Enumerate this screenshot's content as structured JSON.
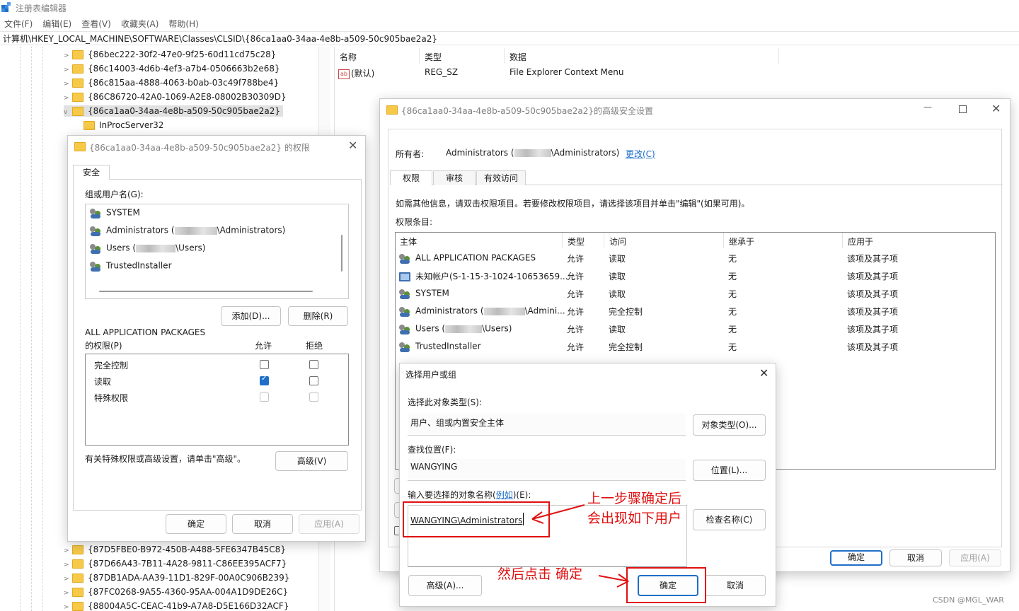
{
  "app": {
    "title": "注册表编辑器"
  },
  "menu": [
    "文件(F)",
    "编辑(E)",
    "查看(V)",
    "收藏夹(A)",
    "帮助(H)"
  ],
  "address": "计算机\\HKEY_LOCAL_MACHINE\\SOFTWARE\\Classes\\CLSID\\{86ca1aa0-34aa-4e8b-a509-50c905bae2a2}",
  "tree": {
    "top": [
      "{86bec222-30f2-47e0-9f25-60d11cd75c28}",
      "{86c14003-4d6b-4ef3-a7b4-0506663b2e68}",
      "{86c815aa-4888-4063-b0ab-03c49f788be4}",
      "{86C86720-42A0-1069-A2E8-08002B30309D}",
      "{86ca1aa0-34aa-4e8b-a509-50c905bae2a2}"
    ],
    "child": "InProcServer32",
    "bottom": [
      "{87D5FBE0-B972-450B-A488-5FE6347B45C8}",
      "{87D66A43-7B11-4A28-9811-C86EE395ACF7}",
      "{87DB1ADA-AA39-11D1-829F-00A0C906B239}",
      "{87FC0268-9A55-4360-95AA-004A1D9DE26C}",
      "{88004A5C-CEAC-41b9-A7A8-D5E166D32ACF}"
    ]
  },
  "values": {
    "headers": [
      "名称",
      "类型",
      "数据"
    ],
    "row": {
      "name": "(默认)",
      "type": "REG_SZ",
      "data": "File Explorer Context Menu"
    }
  },
  "perm": {
    "title": "{86ca1aa0-34aa-4e8b-a509-50c905bae2a2} 的权限",
    "tab": "安全",
    "group_label": "组或用户名(G):",
    "users": [
      {
        "pre": "SYSTEM",
        "post": ""
      },
      {
        "pre": "Administrators (",
        "post": "\\Administrators)"
      },
      {
        "pre": "Users (",
        "post": "\\Users)"
      },
      {
        "pre": "TrustedInstaller",
        "post": ""
      }
    ],
    "add": "添加(D)...",
    "remove": "删除(R)",
    "selected": "ALL APPLICATION PACKAGES",
    "perm_label": "的权限(P)",
    "allow": "允许",
    "deny": "拒绝",
    "rows": [
      {
        "label": "完全控制",
        "allow": false,
        "deny": false
      },
      {
        "label": "读取",
        "allow": true,
        "deny": false
      },
      {
        "label": "特殊权限",
        "allow": false,
        "deny": false
      }
    ],
    "adv_hint": "有关特殊权限或高级设置，请单击\"高级\"。",
    "advanced": "高级(V)",
    "ok": "确定",
    "cancel": "取消",
    "apply": "应用(A)"
  },
  "adv": {
    "title": "{86ca1aa0-34aa-4e8b-a509-50c905bae2a2}的高级安全设置",
    "owner_label": "所有者:",
    "owner_pre": "Administrators (",
    "owner_post": "\\Administrators)",
    "change": "更改(C)",
    "tabs": [
      "权限",
      "审核",
      "有效访问"
    ],
    "info": "如需其他信息，请双击权限项目。若要修改权限项目，请选择该项目并单击\"编辑\"(如果可用)。",
    "entries_label": "权限条目:",
    "headers": [
      "主体",
      "类型",
      "访问",
      "继承于",
      "应用于"
    ],
    "rows": [
      {
        "p": "ALL APPLICATION PACKAGES",
        "t": "允许",
        "a": "读取",
        "i": "无",
        "ap": "该项及其子项"
      },
      {
        "p": "未知帐户(S-1-15-3-1024-10653659...",
        "t": "允许",
        "a": "读取",
        "i": "无",
        "ap": "该项及其子项"
      },
      {
        "p": "SYSTEM",
        "t": "允许",
        "a": "读取",
        "i": "无",
        "ap": "该项及其子项"
      },
      {
        "p": "Administrators (",
        "p2": "\\Admini...",
        "t": "允许",
        "a": "完全控制",
        "i": "无",
        "ap": "该项及其子项"
      },
      {
        "p": "Users (",
        "p2": "\\Users)",
        "t": "允许",
        "a": "读取",
        "i": "无",
        "ap": "该项及其子项"
      },
      {
        "p": "TrustedInstaller",
        "t": "允许",
        "a": "完全控制",
        "i": "无",
        "ap": "该项及其子项"
      }
    ],
    "ok": "确定",
    "cancel": "取消",
    "apply": "应用(A)"
  },
  "sel": {
    "title": "选择用户或组",
    "type_label": "选择此对象类型(S):",
    "type_value": "用户、组或内置安全主体",
    "type_btn": "对象类型(O)...",
    "loc_label": "查找位置(F):",
    "loc_value": "WANGYING",
    "loc_btn": "位置(L)...",
    "name_label_pre": "输入要选择的对象名称(",
    "name_label_link": "例如",
    "name_label_post": ")(E):",
    "name_value": "WANGYING\\Administrators",
    "check": "检查名称(C)",
    "advanced": "高级(A)...",
    "ok": "确定",
    "cancel": "取消"
  },
  "annotations": {
    "a1_line1": "上一步骤确定后",
    "a1_line2": "会出现如下用户",
    "a2": "然后点击 确定"
  },
  "watermark": "CSDN @MGL_WAR"
}
